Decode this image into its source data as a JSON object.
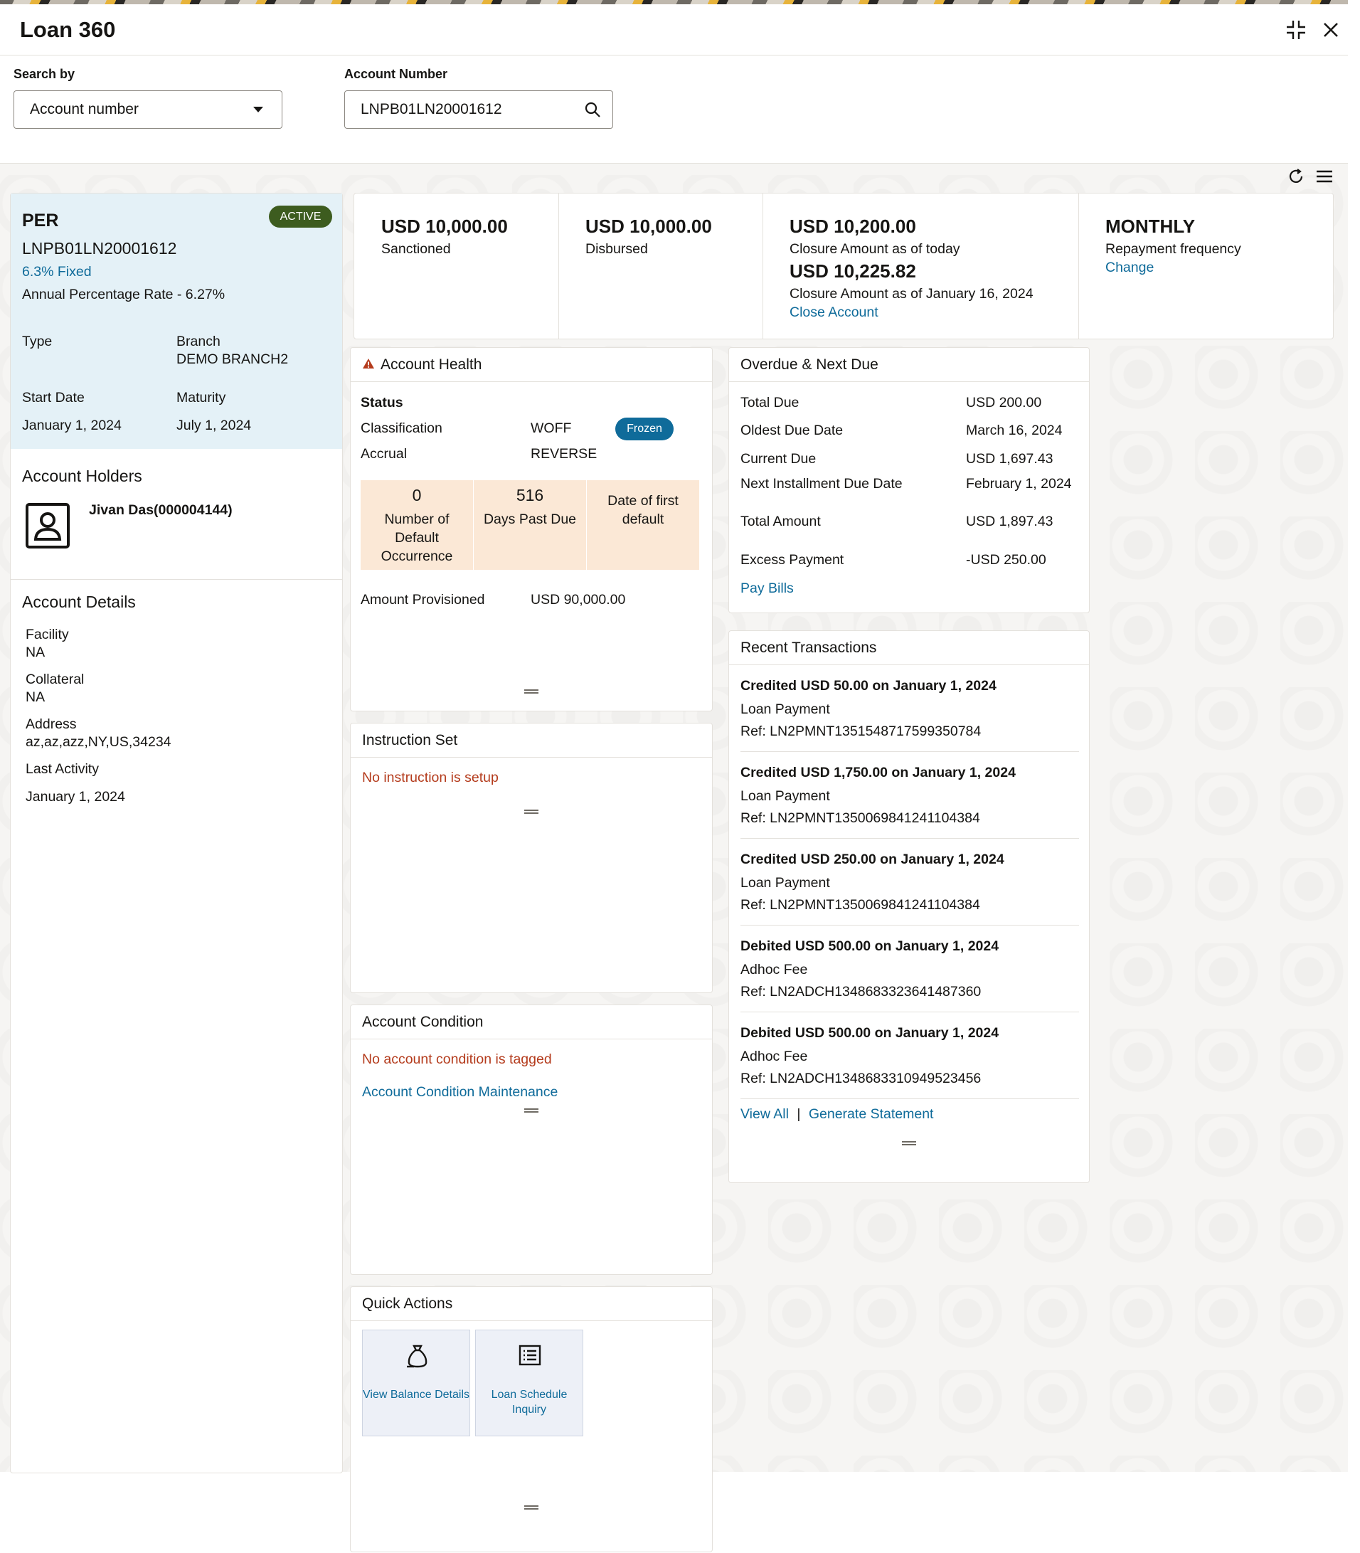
{
  "app": {
    "title": "Loan 360"
  },
  "search": {
    "by_label": "Search by",
    "by_value": "Account number",
    "account_label": "Account Number",
    "account_value": "LNPB01LN20001612"
  },
  "summary": {
    "product": "PER",
    "status": "ACTIVE",
    "account": "LNPB01LN20001612",
    "rate": "6.3% Fixed",
    "apr": "Annual Percentage Rate - 6.27%",
    "type_label": "Type",
    "branch_label": "Branch",
    "branch_value": "DEMO BRANCH2",
    "start_label": "Start Date",
    "start_value": "January 1, 2024",
    "maturity_label": "Maturity",
    "maturity_value": "July 1, 2024"
  },
  "holders": {
    "title": "Account Holders",
    "name": "Jivan Das(000004144)"
  },
  "details": {
    "title": "Account Details",
    "facility_label": "Facility",
    "facility_value": "NA",
    "collateral_label": "Collateral",
    "collateral_value": "NA",
    "address_label": "Address",
    "address_value": "az,az,azz,NY,US,34234",
    "activity_label": "Last Activity",
    "activity_value": "January 1, 2024"
  },
  "amounts": {
    "sanctioned_value": "USD 10,000.00",
    "sanctioned_label": "Sanctioned",
    "disbursed_value": "USD 10,000.00",
    "disbursed_label": "Disbursed",
    "closure_today_value": "USD 10,200.00",
    "closure_today_label": "Closure Amount as of today",
    "closure_date_value": "USD 10,225.82",
    "closure_date_label": "Closure Amount as of January 16, 2024",
    "close_link": "Close Account",
    "frequency_value": "MONTHLY",
    "frequency_label": "Repayment frequency",
    "change_link": "Change"
  },
  "health": {
    "title": "Account Health",
    "status_label": "Status",
    "classification_label": "Classification",
    "classification_value": "WOFF",
    "frozen_badge": "Frozen",
    "accrual_label": "Accrual",
    "accrual_value": "REVERSE",
    "tile1_value": "0",
    "tile1_label": "Number of Default Occurrence",
    "tile2_value": "516",
    "tile2_label": "Days Past Due",
    "tile3_label": "Date of first default",
    "provisioned_label": "Amount Provisioned",
    "provisioned_value": "USD 90,000.00"
  },
  "instruction": {
    "title": "Instruction Set",
    "message": "No instruction is setup"
  },
  "condition": {
    "title": "Account Condition",
    "message": "No account condition is tagged",
    "link": "Account Condition Maintenance"
  },
  "quick_actions": {
    "title": "Quick Actions",
    "action1": "View Balance Details",
    "action2": "Loan Schedule Inquiry"
  },
  "overdue": {
    "title": "Overdue & Next Due",
    "total_due_label": "Total Due",
    "total_due_value": "USD 200.00",
    "oldest_label": "Oldest Due Date",
    "oldest_value": "March 16, 2024",
    "current_label": "Current Due",
    "current_value": "USD 1,697.43",
    "next_label": "Next Installment Due Date",
    "next_value": "February 1, 2024",
    "total_amount_label": "Total Amount",
    "total_amount_value": "USD 1,897.43",
    "excess_label": "Excess Payment",
    "excess_value": "-USD 250.00",
    "pay_link": "Pay Bills"
  },
  "transactions": {
    "title": "Recent Transactions",
    "items": [
      {
        "head": "Credited USD 50.00 on January 1, 2024",
        "desc": "Loan Payment",
        "ref": "Ref: LN2PMNT1351548717599350784"
      },
      {
        "head": "Credited USD 1,750.00 on January 1, 2024",
        "desc": "Loan Payment",
        "ref": "Ref: LN2PMNT1350069841241104384"
      },
      {
        "head": "Credited USD 250.00 on January 1, 2024",
        "desc": "Loan Payment",
        "ref": "Ref: LN2PMNT1350069841241104384"
      },
      {
        "head": "Debited USD 500.00 on January 1, 2024",
        "desc": "Adhoc Fee",
        "ref": "Ref: LN2ADCH1348683323641487360"
      },
      {
        "head": "Debited USD 500.00 on January 1, 2024",
        "desc": "Adhoc Fee",
        "ref": "Ref: LN2ADCH1348683310949523456"
      }
    ],
    "view_all": "View All",
    "separator": "|",
    "generate": "Generate Statement"
  },
  "colors": {
    "accent": "#0f6b9a",
    "active_badge": "#3d5c1f",
    "frozen_badge": "#0f6b9a",
    "summary_bg": "#e4f1f7",
    "tile_bg": "#fbe8d6",
    "error_text": "#b43b1c"
  }
}
